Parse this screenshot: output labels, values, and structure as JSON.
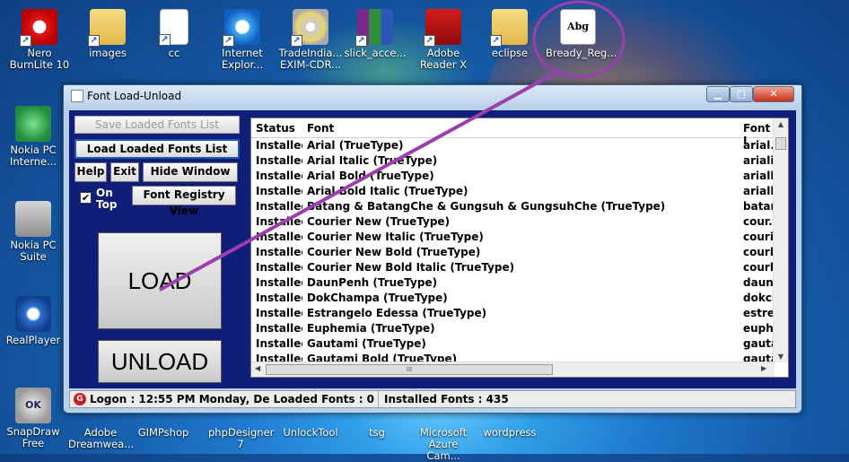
{
  "desktop": {
    "icons_top": [
      {
        "name": "nero-burnlite-icon",
        "label1": "Nero",
        "label2": "BurnLite 10",
        "glyph": "g-nero"
      },
      {
        "name": "images-folder-icon",
        "label1": "images",
        "label2": "",
        "glyph": "g-folder"
      },
      {
        "name": "cc-file-icon",
        "label1": "cc",
        "label2": "",
        "glyph": "g-doc"
      },
      {
        "name": "internet-explorer-icon",
        "label1": "Internet",
        "label2": "Explor...",
        "glyph": "g-ie"
      },
      {
        "name": "tradeindia-icon",
        "label1": "TradeIndia...",
        "label2": "EXIM-CDR...",
        "glyph": "g-cd"
      },
      {
        "name": "slick-access-icon",
        "label1": "slick_acce...",
        "label2": "",
        "glyph": "g-rar"
      },
      {
        "name": "adobe-reader-icon",
        "label1": "Adobe",
        "label2": "Reader X",
        "glyph": "g-pdf"
      },
      {
        "name": "eclipse-folder-icon",
        "label1": "eclipse",
        "label2": "",
        "glyph": "g-folder"
      },
      {
        "name": "bready-font-icon",
        "label1": "Bready_Reg...",
        "label2": "",
        "glyph": "g-font",
        "glyph_text": "Abg"
      }
    ],
    "icons_left": [
      {
        "name": "nokia-pc-internet-icon",
        "label1": "Nokia PC",
        "label2": "Interne...",
        "glyph": "g-nokia"
      },
      {
        "name": "nokia-pc-suite-icon",
        "label1": "Nokia PC",
        "label2": "Suite",
        "glyph": "g-suite"
      },
      {
        "name": "realplayer-icon",
        "label1": "RealPlayer",
        "label2": "",
        "glyph": "g-real"
      },
      {
        "name": "snapdraw-free-icon",
        "label1": "SnapDraw",
        "label2": "Free",
        "glyph": "g-ok",
        "glyph_text": "OK"
      }
    ],
    "icons_bottom": [
      {
        "name": "adobe-dreamweaver-icon",
        "label1": "Adobe",
        "label2": "Dreamwea..."
      },
      {
        "name": "gimpshop-icon",
        "label1": "GIMPshop",
        "label2": ""
      },
      {
        "name": "phpdesigner-icon",
        "label1": "phpDesigner",
        "label2": "7"
      },
      {
        "name": "unlocktool-icon",
        "label1": "UnlockTool",
        "label2": ""
      },
      {
        "name": "tsg-icon",
        "label1": "tsg",
        "label2": ""
      },
      {
        "name": "microsoft-azure-icon",
        "label1": "Microsoft",
        "label2": "Azure Cam..."
      },
      {
        "name": "wordpress-icon",
        "label1": "wordpress",
        "label2": ""
      }
    ],
    "annotation_color": "#9b3fae"
  },
  "window": {
    "title": "Font Load-Unload",
    "buttons": {
      "save_list": "Save Loaded Fonts List",
      "load_list": "Load Loaded Fonts List",
      "help": "Help",
      "exit": "Exit",
      "hide": "Hide Window >>",
      "on_top_1": "On",
      "on_top_2": "Top",
      "registry": "Font Registry View",
      "load": "LOAD",
      "unload": "UNLOAD"
    },
    "table": {
      "headers": {
        "status": "Status",
        "font": "Font",
        "file": "Font I"
      },
      "rows": [
        {
          "status": "Installed",
          "font": "Arial (TrueType)",
          "file": "arial.t"
        },
        {
          "status": "Installed",
          "font": "Arial Italic (TrueType)",
          "file": "ariali.t"
        },
        {
          "status": "Installed",
          "font": "Arial Bold (TrueType)",
          "file": "arialbd"
        },
        {
          "status": "Installed",
          "font": "Arial Bold Italic (TrueType)",
          "file": "arialbi"
        },
        {
          "status": "Installed",
          "font": "Batang & BatangChe & Gungsuh & GungsuhChe (TrueType)",
          "file": "batan"
        },
        {
          "status": "Installed",
          "font": "Courier New (TrueType)",
          "file": "cour.t"
        },
        {
          "status": "Installed",
          "font": "Courier New Italic (TrueType)",
          "file": "couri.t"
        },
        {
          "status": "Installed",
          "font": "Courier New Bold (TrueType)",
          "file": "courb"
        },
        {
          "status": "Installed",
          "font": "Courier New Bold Italic (TrueType)",
          "file": "courb"
        },
        {
          "status": "Installed",
          "font": "DaunPenh (TrueType)",
          "file": "daunp"
        },
        {
          "status": "Installed",
          "font": "DokChampa (TrueType)",
          "file": "dokch"
        },
        {
          "status": "Installed",
          "font": "Estrangelo Edessa (TrueType)",
          "file": "estre."
        },
        {
          "status": "Installed",
          "font": "Euphemia (TrueType)",
          "file": "euphe"
        },
        {
          "status": "Installed",
          "font": "Gautami (TrueType)",
          "file": "gauta"
        },
        {
          "status": "Installed",
          "font": "Gautami Bold (TrueType)",
          "file": "gauta"
        }
      ],
      "scroll_grip": "III"
    },
    "status": {
      "logon": "Logon : 12:55 PM Monday, De Loaded Fonts : 0",
      "installed": "Installed Fonts : 435"
    }
  }
}
